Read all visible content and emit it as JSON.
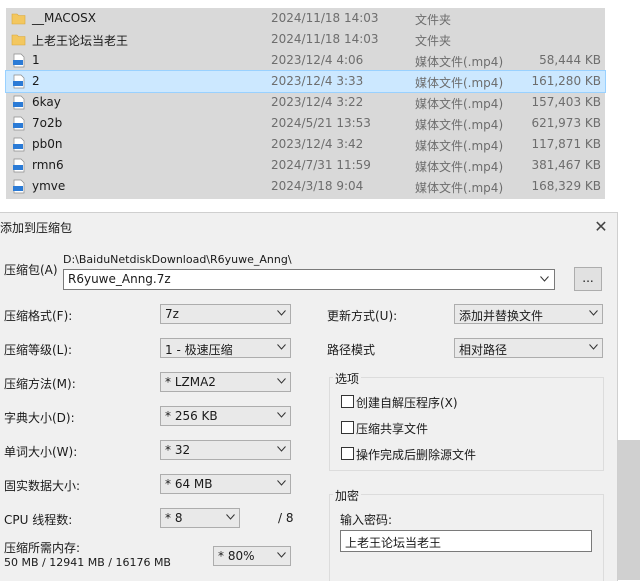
{
  "files": [
    {
      "name": "__MACOSX",
      "date": "2024/11/18 14:03",
      "type": "文件夹",
      "size": "",
      "icon": "folder-icon"
    },
    {
      "name": "上老王论坛当老王",
      "date": "2024/11/18 14:03",
      "type": "文件夹",
      "size": "",
      "icon": "folder-icon"
    },
    {
      "name": "1",
      "date": "2023/12/4 4:06",
      "type": "媒体文件(.mp4)",
      "size": "58,444 KB",
      "icon": "mp4-file-icon"
    },
    {
      "name": "2",
      "date": "2023/12/4 3:33",
      "type": "媒体文件(.mp4)",
      "size": "161,280 KB",
      "icon": "mp4-file-icon"
    },
    {
      "name": "6kay",
      "date": "2023/12/4 3:22",
      "type": "媒体文件(.mp4)",
      "size": "157,403 KB",
      "icon": "mp4-file-icon"
    },
    {
      "name": "7o2b",
      "date": "2024/5/21 13:53",
      "type": "媒体文件(.mp4)",
      "size": "621,973 KB",
      "icon": "mp4-file-icon"
    },
    {
      "name": "pb0n",
      "date": "2023/12/4 3:42",
      "type": "媒体文件(.mp4)",
      "size": "117,871 KB",
      "icon": "mp4-file-icon"
    },
    {
      "name": "rmn6",
      "date": "2024/7/31 11:59",
      "type": "媒体文件(.mp4)",
      "size": "381,467 KB",
      "icon": "mp4-file-icon"
    },
    {
      "name": "ymve",
      "date": "2024/3/18 9:04",
      "type": "媒体文件(.mp4)",
      "size": "168,329 KB",
      "icon": "mp4-file-icon"
    }
  ],
  "selected_file_index": 3,
  "dialog": {
    "title": "添加到压缩包",
    "close": "✕",
    "archive_label": "压缩包(A)",
    "archive_path": "D:\\BaiduNetdiskDownload\\R6yuwe_Anng\\",
    "archive_name": "R6yuwe_Anng.7z",
    "browse": "...",
    "format_label": "压缩格式(F):",
    "format_value": "7z",
    "level_label": "压缩等级(L):",
    "level_value": "1 - 极速压缩",
    "method_label": "压缩方法(M):",
    "method_value": "* LZMA2",
    "dict_label": "字典大小(D):",
    "dict_value": "* 256 KB",
    "word_label": "单词大小(W):",
    "word_value": "* 32",
    "solid_label": "固实数据大小:",
    "solid_value": "* 64 MB",
    "threads_label": "CPU 线程数:",
    "threads_value": "* 8",
    "threads_max": "/ 8",
    "memory_label": "压缩所需内存:",
    "memory_info": "50 MB / 12941 MB / 16176 MB",
    "memory_value": "* 80%",
    "update_label": "更新方式(U):",
    "update_value": "添加并替换文件",
    "path_label": "路径模式",
    "path_value": "相对路径",
    "options_title": "选项",
    "opt_sfx": "创建自解压程序(X)",
    "opt_shared": "压缩共享文件",
    "opt_delete": "操作完成后删除源文件",
    "encrypt_title": "加密",
    "password_label": "输入密码:",
    "password_value": "上老王论坛当老王"
  },
  "colors": {
    "selection": "#cce8ff",
    "selection_border": "#99d1ff",
    "folder": "#f3c75f",
    "mp4_icon": "#2b7bd6",
    "list_bg": "#d9d9d9",
    "dialog_bg": "#f0f0f0"
  }
}
